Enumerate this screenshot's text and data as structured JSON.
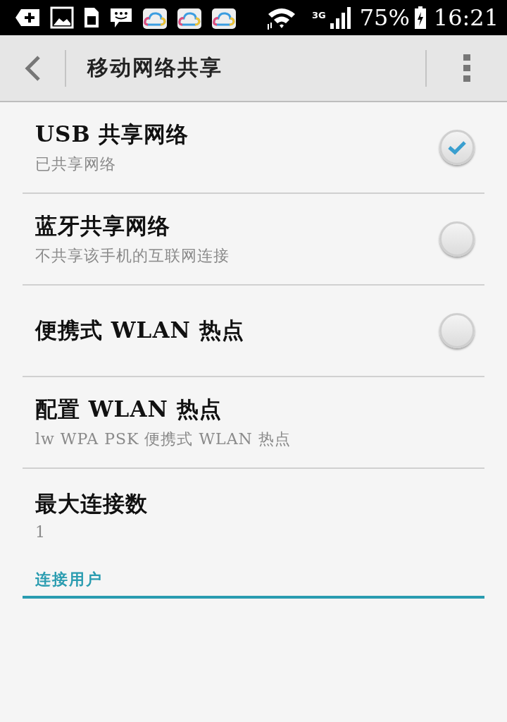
{
  "status_bar": {
    "notifications": [
      {
        "kind": "add"
      },
      {
        "kind": "image"
      },
      {
        "kind": "sim"
      },
      {
        "kind": "chat"
      },
      {
        "kind": "cloud"
      },
      {
        "kind": "cloud"
      },
      {
        "kind": "cloud"
      }
    ],
    "network": "3G",
    "battery": "75%",
    "time": "16:21"
  },
  "action_bar": {
    "title": "移动网络共享"
  },
  "settings": [
    {
      "kind": "toggle",
      "title": "USB 共享网络",
      "summary": "已共享网络",
      "checked": true
    },
    {
      "kind": "toggle",
      "title": "蓝牙共享网络",
      "summary": "不共享该手机的互联网连接",
      "checked": false
    },
    {
      "kind": "toggle",
      "title": "便携式 WLAN 热点",
      "checked": false
    },
    {
      "kind": "plain",
      "title": "配置 WLAN 热点",
      "summary": "lw WPA PSK 便携式 WLAN 热点"
    },
    {
      "kind": "plain",
      "title": "最大连接数",
      "summary": "1"
    }
  ],
  "section": {
    "title": "连接用户"
  }
}
